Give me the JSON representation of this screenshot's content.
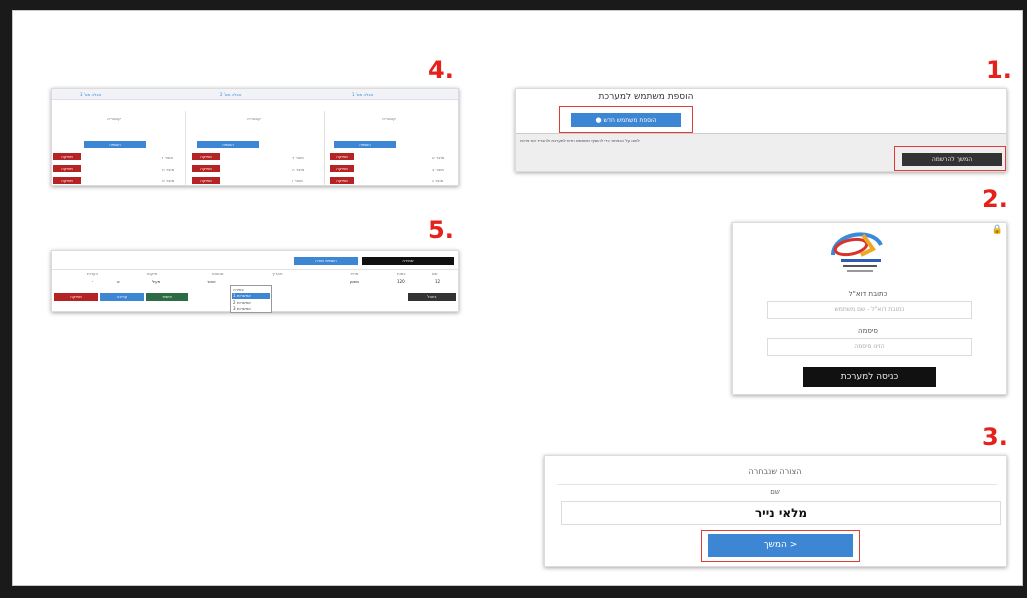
{
  "steps": {
    "s1": "1.",
    "s2": "2.",
    "s3": "3.",
    "s4": "4.",
    "s5": "5."
  },
  "panel1": {
    "title": "הוספת משתמש למערכת",
    "primary_button": "הוספת משתמש חדש",
    "notice": "לחצו על הכפתור כדי להוסיף משתמש חדש למערכת ולהגדיר את פרטיו",
    "secondary_button": "המשך להרשמה"
  },
  "panel2": {
    "lock_glyph": "🔒",
    "email_label": "כתובת דוא\"ל",
    "email_placeholder": "כתובת דוא\"ל - שם משתמש",
    "password_label": "סיסמה",
    "password_placeholder": "הזינו סיסמה",
    "login_button": "כניסה למערכת"
  },
  "panel3": {
    "heading": "הצורה שנבחרה",
    "field_label": "שם",
    "field_value": "מלאי נייר",
    "continue_button": "המשך >"
  },
  "panel4": {
    "columns": [
      {
        "header": "טבלה מס' 1",
        "sub": "קטגוריה",
        "action": "הוספה",
        "rows": [
          "מוצר א",
          "מוצר ב",
          "מוצר ג"
        ],
        "row_action": "מחיקה"
      },
      {
        "header": "טבלה מס' 2",
        "sub": "קטגוריה",
        "action": "הוספה",
        "rows": [
          "מוצר ד",
          "מוצר ה",
          "מוצר ו"
        ],
        "row_action": "מחיקה"
      },
      {
        "header": "טבלה מס' 3",
        "sub": "קטגוריה",
        "action": "הוספה",
        "rows": [
          "מוצר ז",
          "מוצר ח",
          "מוצר ט"
        ],
        "row_action": "מחיקה"
      }
    ]
  },
  "panel5": {
    "top_buttons": [
      "הוספת שורה",
      "שמירה"
    ],
    "headers": [
      "שם",
      "כמות",
      "מחיר",
      "תאריך",
      "סטטוס",
      "מיקום",
      "הערות"
    ],
    "row_values": [
      "12",
      "120",
      "מחסן",
      "ינואר",
      "פעיל",
      "א",
      "-"
    ],
    "dropdown_options": [
      "בחירה",
      "אפשרות 1",
      "אפשרות 2",
      "אפשרות 3"
    ],
    "actions": [
      "אישור",
      "עריכה",
      "מחיקה",
      "ביטול"
    ]
  }
}
